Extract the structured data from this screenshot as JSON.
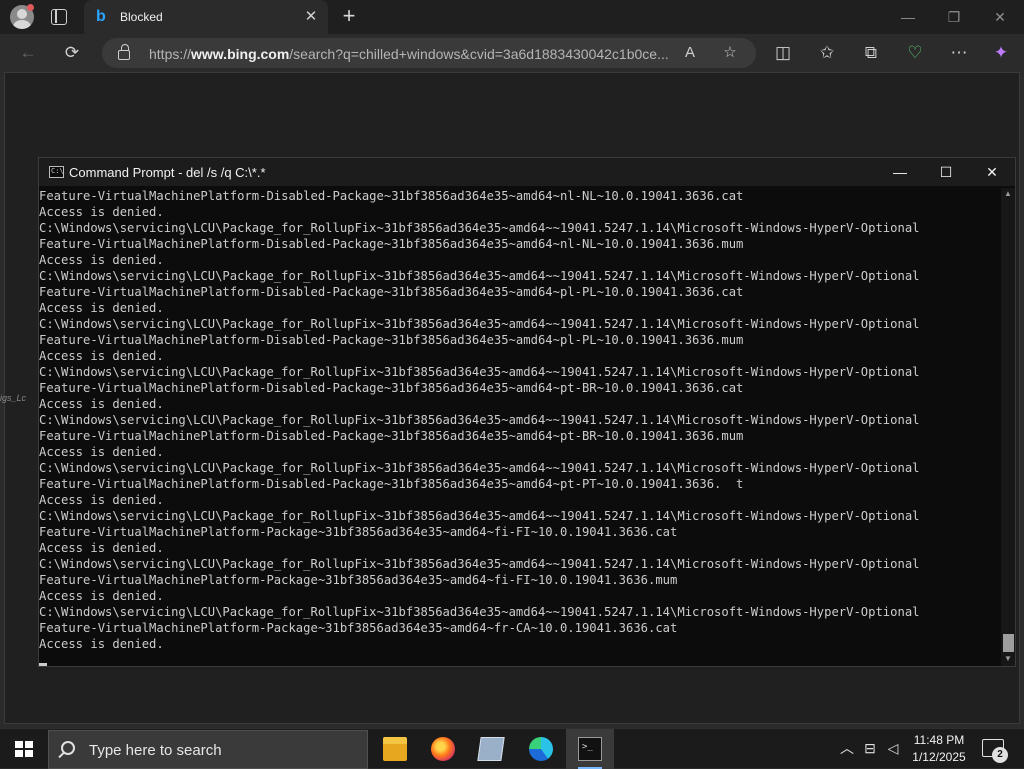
{
  "browser": {
    "tab_title": "Blocked",
    "tab_favicon": "b",
    "url_prefix": "https://",
    "url_domain": "www.bing.com",
    "url_rest": "/search?q=chilled+windows&cvid=3a6d1883430042c1b0ce...",
    "icons": {
      "new_tab": "+",
      "tab_close": "✕",
      "minimize": "—",
      "restore": "❐",
      "close": "✕",
      "back": "←",
      "refresh": "⟳",
      "read_aloud": "A",
      "favorite": "☆",
      "split_screen": "◫",
      "favorites": "✩",
      "collections": "⧉",
      "browser_essentials": "♡",
      "more": "⋯",
      "copilot": "✦"
    }
  },
  "desktop": {
    "partial_label": "igs_Lc"
  },
  "cmd": {
    "title": "Command Prompt - del  /s /q C:\\*.*",
    "minimize": "—",
    "maximize": "☐",
    "close": "✕",
    "lines": [
      "Feature-VirtualMachinePlatform-Disabled-Package~31bf3856ad364e35~amd64~nl-NL~10.0.19041.3636.cat",
      "Access is denied.",
      "C:\\Windows\\servicing\\LCU\\Package_for_RollupFix~31bf3856ad364e35~amd64~~19041.5247.1.14\\Microsoft-Windows-HyperV-Optional",
      "Feature-VirtualMachinePlatform-Disabled-Package~31bf3856ad364e35~amd64~nl-NL~10.0.19041.3636.mum",
      "Access is denied.",
      "C:\\Windows\\servicing\\LCU\\Package_for_RollupFix~31bf3856ad364e35~amd64~~19041.5247.1.14\\Microsoft-Windows-HyperV-Optional",
      "Feature-VirtualMachinePlatform-Disabled-Package~31bf3856ad364e35~amd64~pl-PL~10.0.19041.3636.cat",
      "Access is denied.",
      "C:\\Windows\\servicing\\LCU\\Package_for_RollupFix~31bf3856ad364e35~amd64~~19041.5247.1.14\\Microsoft-Windows-HyperV-Optional",
      "Feature-VirtualMachinePlatform-Disabled-Package~31bf3856ad364e35~amd64~pl-PL~10.0.19041.3636.mum",
      "Access is denied.",
      "C:\\Windows\\servicing\\LCU\\Package_for_RollupFix~31bf3856ad364e35~amd64~~19041.5247.1.14\\Microsoft-Windows-HyperV-Optional",
      "Feature-VirtualMachinePlatform-Disabled-Package~31bf3856ad364e35~amd64~pt-BR~10.0.19041.3636.cat",
      "Access is denied.",
      "C:\\Windows\\servicing\\LCU\\Package_for_RollupFix~31bf3856ad364e35~amd64~~19041.5247.1.14\\Microsoft-Windows-HyperV-Optional",
      "Feature-VirtualMachinePlatform-Disabled-Package~31bf3856ad364e35~amd64~pt-BR~10.0.19041.3636.mum",
      "Access is denied.",
      "C:\\Windows\\servicing\\LCU\\Package_for_RollupFix~31bf3856ad364e35~amd64~~19041.5247.1.14\\Microsoft-Windows-HyperV-Optional",
      "Feature-VirtualMachinePlatform-Disabled-Package~31bf3856ad364e35~amd64~pt-PT~10.0.19041.3636.  t",
      "Access is denied.",
      "C:\\Windows\\servicing\\LCU\\Package_for_RollupFix~31bf3856ad364e35~amd64~~19041.5247.1.14\\Microsoft-Windows-HyperV-Optional",
      "Feature-VirtualMachinePlatform-Package~31bf3856ad364e35~amd64~fi-FI~10.0.19041.3636.cat",
      "Access is denied.",
      "C:\\Windows\\servicing\\LCU\\Package_for_RollupFix~31bf3856ad364e35~amd64~~19041.5247.1.14\\Microsoft-Windows-HyperV-Optional",
      "Feature-VirtualMachinePlatform-Package~31bf3856ad364e35~amd64~fi-FI~10.0.19041.3636.mum",
      "Access is denied.",
      "C:\\Windows\\servicing\\LCU\\Package_for_RollupFix~31bf3856ad364e35~amd64~~19041.5247.1.14\\Microsoft-Windows-HyperV-Optional",
      "Feature-VirtualMachinePlatform-Package~31bf3856ad364e35~amd64~fr-CA~10.0.19041.3636.cat",
      "Access is denied."
    ]
  },
  "taskbar": {
    "search_placeholder": "Type here to search",
    "clock_time": "11:48 PM",
    "clock_date": "1/12/2025",
    "notification_count": "2",
    "tray_icons": {
      "chevron": "︿",
      "network": "⊟",
      "volume": "◁"
    },
    "apps": [
      "file-explorer-icon",
      "firefox-icon",
      "windows-explorer-icon",
      "edge-icon",
      "command-prompt-icon"
    ]
  },
  "colors": {
    "accent_blue": "#2aa3ff",
    "console_text": "#cccccc",
    "console_bg": "#0c0c0c"
  }
}
